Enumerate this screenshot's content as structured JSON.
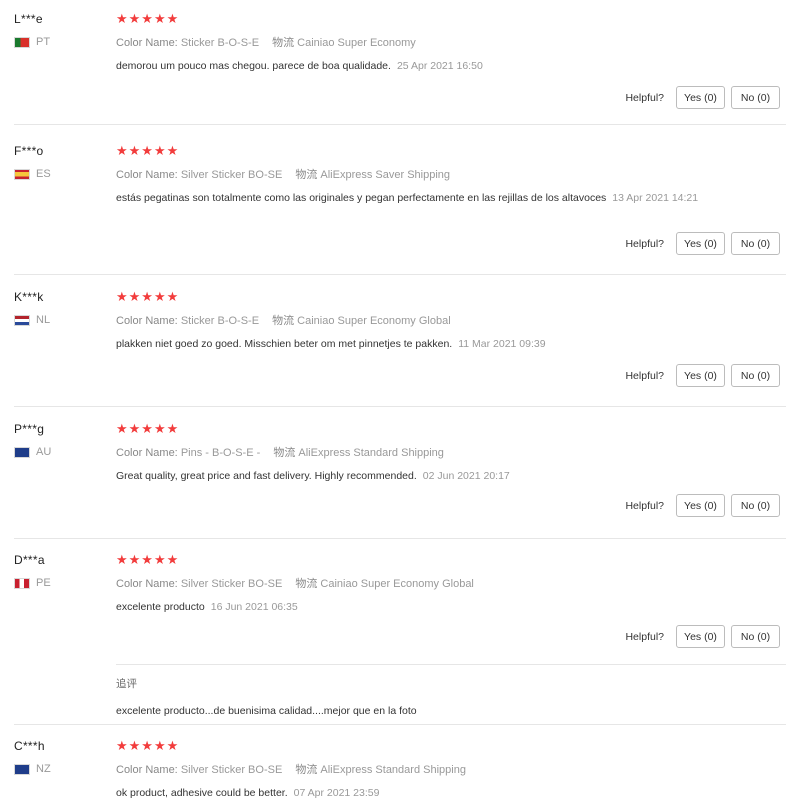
{
  "helpful_label": "Helpful?",
  "colors": {
    "star": "#f23c3c",
    "border": "#e6e6e6"
  },
  "reviews": [
    {
      "user": "L***e",
      "country": "PT",
      "flag_icon": "portugal-flag-icon",
      "stars": "★★★★★",
      "color_label": "Color Name:",
      "color_value": "Sticker B-O-S-E",
      "shipping_label": "物流",
      "shipping_value": "Cainiao Super Economy",
      "text": "demorou um pouco mas chegou. parece de boa qualidade.",
      "date": "25 Apr 2021 16:50",
      "yes_label": "Yes (0)",
      "no_label": "No (0)"
    },
    {
      "user": "F***o",
      "country": "ES",
      "flag_icon": "spain-flag-icon",
      "stars": "★★★★★",
      "color_label": "Color Name:",
      "color_value": "Silver Sticker BO-SE",
      "shipping_label": "物流",
      "shipping_value": "AliExpress Saver Shipping",
      "text": "estás pegatinas son totalmente como las originales y pegan perfectamente en las rejillas de los altavoces",
      "date": "13 Apr 2021 14:21",
      "yes_label": "Yes (0)",
      "no_label": "No (0)"
    },
    {
      "user": "K***k",
      "country": "NL",
      "flag_icon": "netherlands-flag-icon",
      "stars": "★★★★★",
      "color_label": "Color Name:",
      "color_value": "Sticker B-O-S-E",
      "shipping_label": "物流",
      "shipping_value": "Cainiao Super Economy Global",
      "text": "plakken niet goed zo goed. Misschien beter om met pinnetjes te pakken.",
      "date": "11 Mar 2021 09:39",
      "yes_label": "Yes (0)",
      "no_label": "No (0)"
    },
    {
      "user": "P***g",
      "country": "AU",
      "flag_icon": "australia-flag-icon",
      "stars": "★★★★★",
      "color_label": "Color Name:",
      "color_value": "Pins - B-O-S-E -",
      "shipping_label": "物流",
      "shipping_value": "AliExpress Standard Shipping",
      "text": "Great quality, great price and fast delivery. Highly recommended.",
      "date": "02 Jun 2021 20:17",
      "yes_label": "Yes (0)",
      "no_label": "No (0)"
    },
    {
      "user": "D***a",
      "country": "PE",
      "flag_icon": "peru-flag-icon",
      "stars": "★★★★★",
      "color_label": "Color Name:",
      "color_value": "Silver Sticker BO-SE",
      "shipping_label": "物流",
      "shipping_value": "Cainiao Super Economy Global",
      "text": "excelente producto",
      "date": "16 Jun 2021 06:35",
      "yes_label": "Yes (0)",
      "no_label": "No (0)",
      "followup_label": "追评",
      "followup_text": "excelente producto...de buenisima calidad....mejor que en la foto"
    },
    {
      "user": "C***h",
      "country": "NZ",
      "flag_icon": "new-zealand-flag-icon",
      "stars": "★★★★★",
      "color_label": "Color Name:",
      "color_value": "Silver Sticker BO-SE",
      "shipping_label": "物流",
      "shipping_value": "AliExpress Standard Shipping",
      "text": "ok product, adhesive could be better.",
      "date": "07 Apr 2021 23:59"
    }
  ]
}
